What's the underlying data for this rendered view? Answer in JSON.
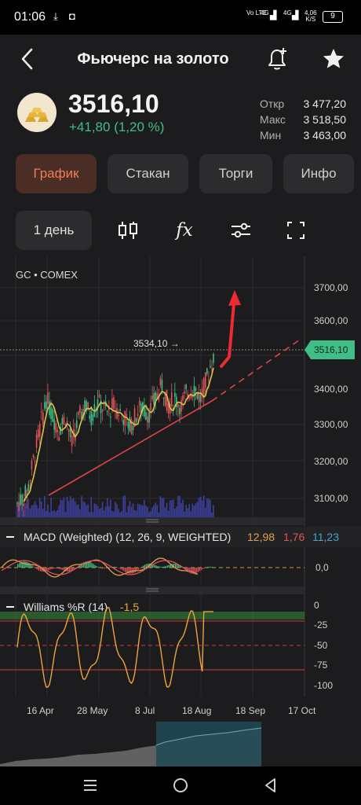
{
  "status_bar": {
    "time": "01:06",
    "net1": "Vo LTE",
    "net2": "4G",
    "net3": "4G",
    "speed_value": "4,06",
    "speed_unit": "K/S",
    "battery": "9"
  },
  "header": {
    "title": "Фьючерс на золото"
  },
  "quote": {
    "price": "3516,10",
    "change": "+41,80 (1,20 %)",
    "open_label": "Откр",
    "open_value": "3 477,20",
    "high_label": "Макс",
    "high_value": "3 518,50",
    "low_label": "Мин",
    "low_value": "3 463,00"
  },
  "tabs": [
    {
      "label": "График"
    },
    {
      "label": "Стакан"
    },
    {
      "label": "Торги"
    },
    {
      "label": "Инфо"
    }
  ],
  "toolbar": {
    "period": "1 день",
    "indicator_glyph": "fx"
  },
  "chart": {
    "symbol": "GC",
    "exchange": "COMEX",
    "price_axis": [
      "3700,00",
      "3600,00",
      "3500,00",
      "3400,00",
      "3300,00",
      "3200,00",
      "3100,00"
    ],
    "current_price_label": "3516,10",
    "max_marker": "3534,10 →",
    "macd_title": "MACD (Weighted) (12, 26, 9, WEIGHTED)",
    "macd_v1": "12,98",
    "macd_v2": "1,76",
    "macd_v3": "11,23",
    "macd_axis": "0,0",
    "wr_title": "Williams %R (14)",
    "wr_value": "-1,5",
    "wr_axis": [
      "0",
      "-25",
      "-50",
      "-75",
      "-100"
    ],
    "date_axis": [
      "16 Apr",
      "28 May",
      "8 Jul",
      "18 Aug",
      "18 Sep",
      "17 Oct"
    ],
    "colors": {
      "up": "#3fbf87",
      "down": "#e0555b",
      "ma": "#d9c44a",
      "trend": "#e0444a",
      "volume": "#3d3f9c",
      "wr_line": "#f0a23a",
      "price_tag": "#3fbf87"
    }
  },
  "chart_data": {
    "type": "line",
    "title": "",
    "xlabel": "",
    "ylabel": "",
    "x": [
      "16 Apr",
      "28 May",
      "8 Jul",
      "18 Aug"
    ],
    "ylim": [
      3050,
      3720
    ],
    "series": [
      {
        "values": [
          3320,
          3300,
          3340,
          3460
        ]
      }
    ]
  }
}
